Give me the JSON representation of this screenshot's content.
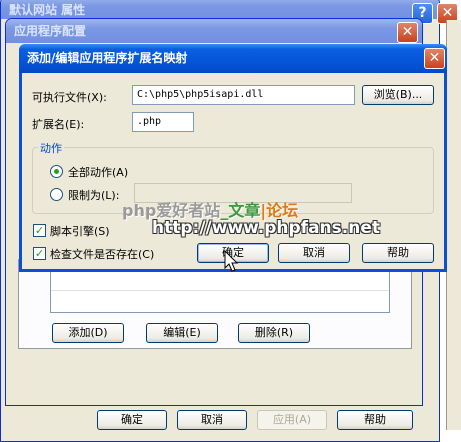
{
  "back_window": {
    "title": "默认网站 属性",
    "buttons": {
      "ok": "确定",
      "cancel": "取消",
      "apply": "应用(A)",
      "help": "帮助"
    }
  },
  "mid_window": {
    "title": "应用程序配置",
    "buttons": {
      "add": "添加(D)",
      "edit": "编辑(E)",
      "delete": "删除(R)"
    }
  },
  "dialog": {
    "title": "添加/编辑应用程序扩展名映射",
    "exe_label": "可执行文件(X):",
    "exe_value": "C:\\php5\\php5isapi.dll",
    "browse_label": "浏览(B)...",
    "ext_label": "扩展名(E):",
    "ext_value": ".php",
    "actions_group": "动作",
    "all_verbs": "全部动作(A)",
    "limit_to": "限制为(L):",
    "limit_value": "",
    "script_engine": "脚本引擎(S)",
    "check_file": "检查文件是否存在(C)",
    "ok": "确定",
    "cancel": "取消",
    "help": "帮助"
  },
  "watermark": {
    "part1": "php爱好者站",
    "part2": "_文章",
    "part3": "|论坛",
    "url": "http://www.phpfans.net"
  },
  "colors": {
    "xp_blue": "#0555d9",
    "dialog_bg": "#ece9d8"
  }
}
